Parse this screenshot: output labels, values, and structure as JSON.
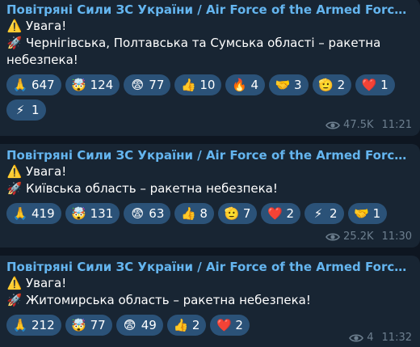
{
  "messages": [
    {
      "channel": "Повітряні Сили ЗС України / Air Force of the Armed Forces of U...",
      "warning_icon": "⚠️",
      "warning_text": "Увага!",
      "rocket_icon": "🚀",
      "alert_text": "Чернігівська, Полтавська та Сумська області – ракетна небезпека!",
      "reactions": [
        {
          "emoji": "🙏",
          "count": "647"
        },
        {
          "emoji": "🤯",
          "count": "124"
        },
        {
          "emoji": "😨",
          "count": "77"
        },
        {
          "emoji": "👍",
          "count": "10"
        },
        {
          "emoji": "🔥",
          "count": "4"
        },
        {
          "emoji": "🤝",
          "count": "3"
        },
        {
          "emoji": "🫡",
          "count": "2"
        },
        {
          "emoji": "❤️",
          "count": "1"
        },
        {
          "emoji": "⚡",
          "count": "1"
        }
      ],
      "views": "47.5K",
      "time": "11:21"
    },
    {
      "channel": "Повітряні Сили ЗС України / Air Force of the Armed Forces of U...",
      "warning_icon": "⚠️",
      "warning_text": "Увага!",
      "rocket_icon": "🚀",
      "alert_text": "Київська область – ракетна небезпека!",
      "reactions": [
        {
          "emoji": "🙏",
          "count": "419"
        },
        {
          "emoji": "🤯",
          "count": "131"
        },
        {
          "emoji": "😨",
          "count": "63"
        },
        {
          "emoji": "👍",
          "count": "8"
        },
        {
          "emoji": "🫡",
          "count": "7"
        },
        {
          "emoji": "❤️",
          "count": "2"
        },
        {
          "emoji": "⚡",
          "count": "2"
        },
        {
          "emoji": "🤝",
          "count": "1"
        }
      ],
      "views": "25.2K",
      "time": "11:30"
    },
    {
      "channel": "Повітряні Сили ЗС України / Air Force of the Armed Forces of U...",
      "warning_icon": "⚠️",
      "warning_text": "Увага!",
      "rocket_icon": "🚀",
      "alert_text": "Житомирська область – ракетна небезпека!",
      "reactions": [
        {
          "emoji": "🙏",
          "count": "212"
        },
        {
          "emoji": "🤯",
          "count": "77"
        },
        {
          "emoji": "😨",
          "count": "49"
        },
        {
          "emoji": "👍",
          "count": "2"
        },
        {
          "emoji": "❤️",
          "count": "2"
        }
      ],
      "views": "4",
      "time": "11:32"
    }
  ]
}
